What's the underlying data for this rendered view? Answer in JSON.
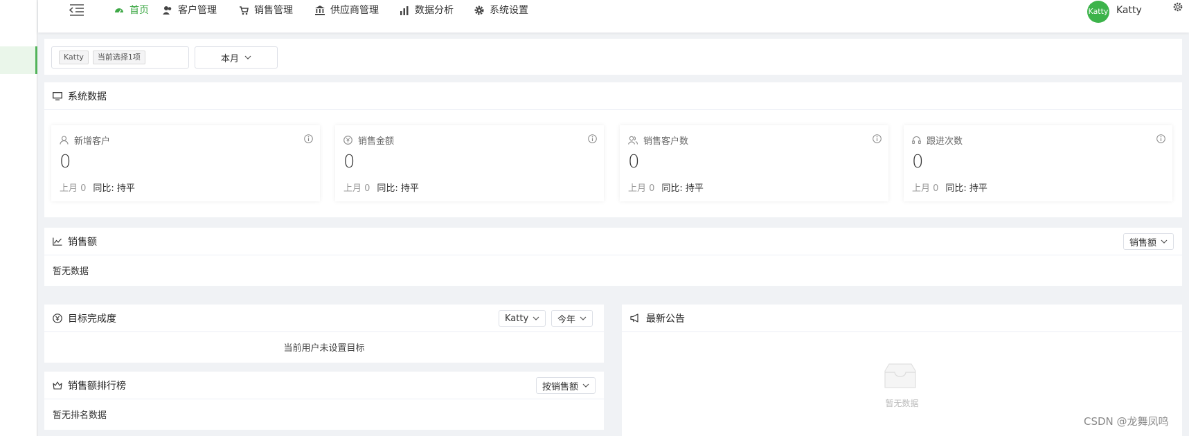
{
  "nav": {
    "items": [
      {
        "label": "首页",
        "icon": "dashboard-icon",
        "active": true
      },
      {
        "label": "客户管理",
        "icon": "users-icon",
        "active": false
      },
      {
        "label": "销售管理",
        "icon": "cart-icon",
        "active": false
      },
      {
        "label": "供应商管理",
        "icon": "bank-icon",
        "active": false
      },
      {
        "label": "数据分析",
        "icon": "bar-chart-icon",
        "active": false
      },
      {
        "label": "系统设置",
        "icon": "gear-icon",
        "active": false
      }
    ],
    "user": {
      "avatar_text": "Katty",
      "name": "Katty"
    }
  },
  "filter": {
    "user_tag": "Katty",
    "selected_count": "当前选择1项",
    "period": "本月"
  },
  "system_data": {
    "title": "系统数据",
    "cards": [
      {
        "label": "新增客户",
        "icon": "user-icon",
        "value": "0",
        "last_month": "上月 0",
        "compare": "同比: 持平"
      },
      {
        "label": "销售金额",
        "icon": "yen-icon",
        "value": "0",
        "last_month": "上月 0",
        "compare": "同比: 持平"
      },
      {
        "label": "销售客户数",
        "icon": "users-outline-icon",
        "value": "0",
        "last_month": "上月 0",
        "compare": "同比: 持平"
      },
      {
        "label": "跟进次数",
        "icon": "headset-icon",
        "value": "0",
        "last_month": "上月 0",
        "compare": "同比: 持平"
      }
    ]
  },
  "sales": {
    "title": "销售额",
    "dropdown": "销售额",
    "empty": "暂无数据"
  },
  "goal": {
    "title": "目标完成度",
    "user_dropdown": "Katty",
    "period_dropdown": "今年",
    "empty": "当前用户未设置目标"
  },
  "ranking": {
    "title": "销售额排行榜",
    "dropdown": "按销售额",
    "empty": "暂无排名数据"
  },
  "notice": {
    "title": "最新公告",
    "empty": "暂无数据"
  },
  "watermark": "CSDN @龙舞凤鸣",
  "colors": {
    "accent": "#3ea846",
    "avatar": "#3cb34a"
  }
}
